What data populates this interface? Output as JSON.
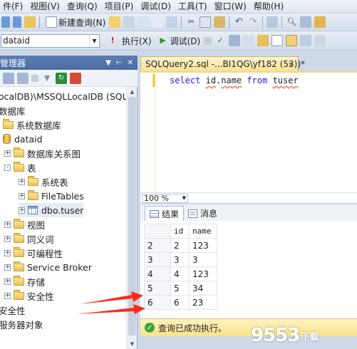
{
  "menu": {
    "items": [
      "件(F)",
      "视图(V)",
      "查询(Q)",
      "项目(P)",
      "调试(D)",
      "工具(T)",
      "窗口(W)",
      "帮助(H)"
    ]
  },
  "toolbar1": {
    "new_query_label": "新建查询(N)"
  },
  "toolbar2": {
    "database_value": "dataid",
    "execute_label": "执行(X)",
    "debug_label": "调试(D)"
  },
  "object_explorer": {
    "title": "管理器",
    "pin_icon": "pin-icon",
    "close_icon": "close-icon",
    "tree": [
      {
        "label": "ocalDB)\\MSSQLLocalDB (SQL S",
        "indent": 0,
        "icon": "server-icon",
        "expander": ""
      },
      {
        "label": "数据库",
        "indent": 0,
        "icon": "none",
        "expander": ""
      },
      {
        "label": "系统数据库",
        "indent": 1,
        "icon": "folder-icon",
        "expander": ""
      },
      {
        "label": "dataid",
        "indent": 1,
        "icon": "database-icon",
        "expander": ""
      },
      {
        "label": "数据库关系图",
        "indent": 2,
        "icon": "folder-icon",
        "expander": "+"
      },
      {
        "label": "表",
        "indent": 2,
        "icon": "folder-icon",
        "expander": "-"
      },
      {
        "label": "系统表",
        "indent": 3,
        "icon": "folder-icon",
        "expander": "+"
      },
      {
        "label": "FileTables",
        "indent": 3,
        "icon": "folder-icon",
        "expander": "+"
      },
      {
        "label": "dbo.tuser",
        "indent": 3,
        "icon": "table-icon",
        "expander": "+",
        "selected": true
      },
      {
        "label": "视图",
        "indent": 2,
        "icon": "folder-icon",
        "expander": "+"
      },
      {
        "label": "同义词",
        "indent": 2,
        "icon": "folder-icon",
        "expander": "+"
      },
      {
        "label": "可编程性",
        "indent": 2,
        "icon": "folder-icon",
        "expander": "+"
      },
      {
        "label": "Service Broker",
        "indent": 2,
        "icon": "folder-icon",
        "expander": "+"
      },
      {
        "label": "存储",
        "indent": 2,
        "icon": "folder-icon",
        "expander": "+"
      },
      {
        "label": "安全性",
        "indent": 2,
        "icon": "folder-icon",
        "expander": "+"
      },
      {
        "label": "安全性",
        "indent": 0,
        "icon": "none",
        "expander": ""
      },
      {
        "label": "服务器对象",
        "indent": 0,
        "icon": "none",
        "expander": ""
      }
    ]
  },
  "editor": {
    "tab_title": "SQLQuery2.sql -...BI1QG\\yf182 (53))*",
    "tab_close": "×",
    "sql": {
      "kw_select": "select",
      "col_id": "id",
      "dot": ".",
      "col_name": "name",
      "kw_from": "from",
      "table": "tuser"
    },
    "zoom": "100 %"
  },
  "results": {
    "tabs": [
      "结果",
      "消息"
    ],
    "columns": [
      "id",
      "name"
    ],
    "rows": [
      {
        "num": "2",
        "id": "2",
        "name": "123"
      },
      {
        "num": "3",
        "id": "3",
        "name": "3"
      },
      {
        "num": "4",
        "id": "4",
        "name": "123"
      },
      {
        "num": "5",
        "id": "5",
        "name": "34"
      },
      {
        "num": "6",
        "id": "6",
        "name": "23"
      }
    ]
  },
  "status": {
    "message": "查询已成功执行。",
    "status_color": "#3da53d"
  },
  "watermark": {
    "main": "9553",
    "sub": "下载"
  },
  "colors": {
    "titlebar": "#4a6ca2",
    "tab_active": "#f8e39a",
    "keyword": "#1a1aff",
    "arrow": "#ff2a1a"
  }
}
